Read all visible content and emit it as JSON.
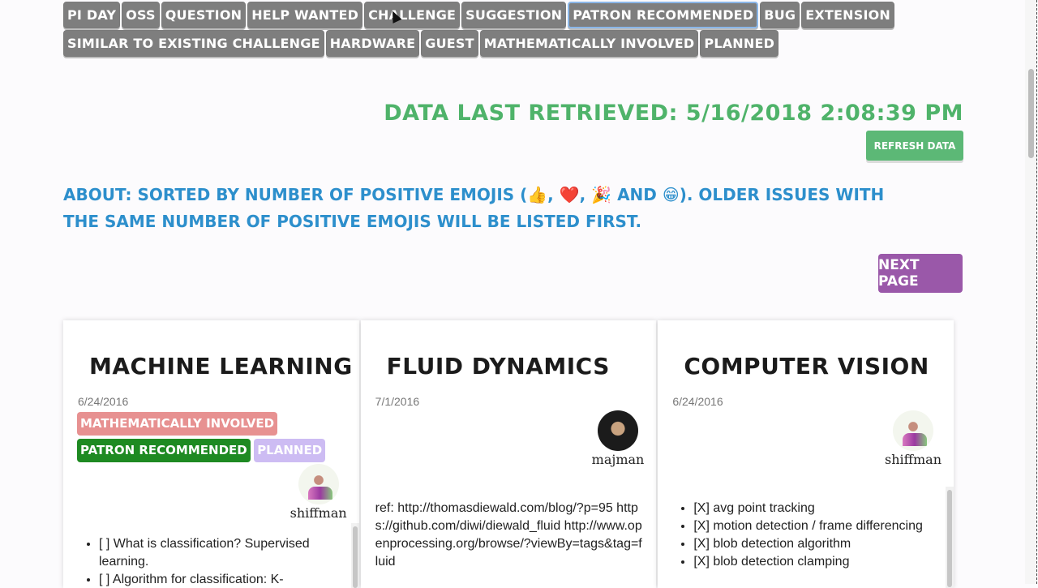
{
  "labels": {
    "row1": [
      "Pi Day",
      "OSS",
      "Question",
      "Help Wanted",
      "Challenge",
      "Suggestion",
      "Patron Recommended",
      "Bug",
      "Extension"
    ],
    "row2": [
      "Similar to existing challenge",
      "Hardware",
      "Guest",
      "Mathematically Involved",
      "Planned"
    ],
    "active": "Patron Recommended"
  },
  "header": {
    "retrieved": "Data last retrieved: 5/16/2018 2:08:39 PM",
    "refresh_label": "Refresh Data",
    "about": "About: Sorted by number of positive emojis (👍, ❤️, 🎉 and 😁). Older issues with the same number of positive emojis will be listed first.",
    "next_label": "Next Page"
  },
  "colors": {
    "label_gray": "#7e7e7e",
    "green": "#4fb36a",
    "blue": "#2d8fcc",
    "purple": "#9a58a9",
    "tag_math": "#e79191",
    "tag_patron": "#1e8a22",
    "tag_planned": "#cdbcf3"
  },
  "cards": [
    {
      "title": "Machine Learning",
      "date": "6/24/2016",
      "tags": [
        "Mathematically Involved",
        "Patron Recommended",
        "Planned"
      ],
      "author": "shiffman",
      "items": [
        "[ ] What is classification? Supervised learning.",
        "[ ] Algorithm for classification: K-"
      ]
    },
    {
      "title": "Fluid Dynamics",
      "date": "7/1/2016",
      "author": "majman",
      "text": "ref: http://thomasdiewald.com/blog/?p=95 https://github.com/diwi/diewald_fluid http://www.openprocessing.org/browse/?viewBy=tags&tag=fluid"
    },
    {
      "title": "Computer Vision",
      "date": "6/24/2016",
      "author": "shiffman",
      "items": [
        "[X] avg point tracking",
        "[X] motion detection / frame differencing",
        "[X] blob detection algorithm",
        "[X] blob detection clamping"
      ]
    }
  ]
}
